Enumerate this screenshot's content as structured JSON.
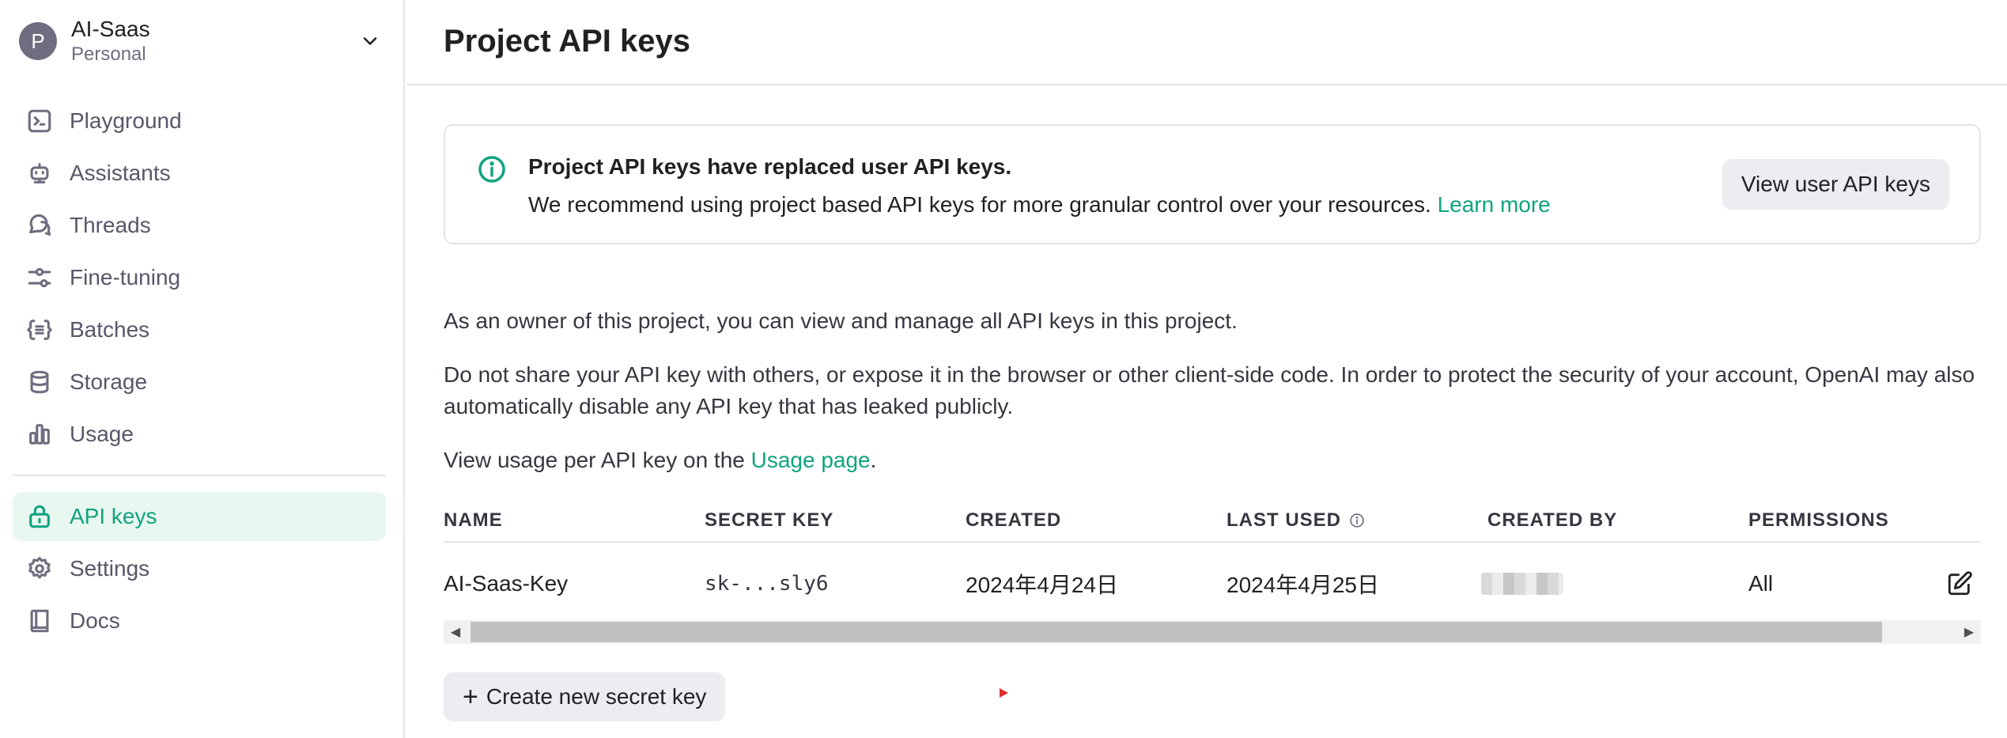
{
  "org": {
    "avatar_letter": "P",
    "name": "AI-Saas",
    "subtitle": "Personal"
  },
  "sidebar": {
    "items": [
      {
        "label": "Playground",
        "icon": "terminal-icon"
      },
      {
        "label": "Assistants",
        "icon": "robot-icon"
      },
      {
        "label": "Threads",
        "icon": "chat-bubbles-icon"
      },
      {
        "label": "Fine-tuning",
        "icon": "sliders-icon"
      },
      {
        "label": "Batches",
        "icon": "braces-list-icon"
      },
      {
        "label": "Storage",
        "icon": "database-icon"
      },
      {
        "label": "Usage",
        "icon": "bar-chart-icon"
      }
    ],
    "bottom_items": [
      {
        "label": "API keys",
        "icon": "lock-icon",
        "active": true
      },
      {
        "label": "Settings",
        "icon": "gear-icon"
      },
      {
        "label": "Docs",
        "icon": "book-icon"
      }
    ]
  },
  "header": {
    "title": "Project API keys"
  },
  "notice": {
    "title": "Project API keys have replaced user API keys.",
    "body": "We recommend using project based API keys for more granular control over your resources.",
    "link": "Learn more",
    "button": "View user API keys"
  },
  "info": {
    "p1": "As an owner of this project, you can view and manage all API keys in this project.",
    "p2": "Do not share your API key with others, or expose it in the browser or other client-side code. In order to protect the security of your account, OpenAI may also automatically disable any API key that has leaked publicly.",
    "p3_prefix": "View usage per API key on the",
    "p3_link": "Usage page",
    "p3_suffix": "."
  },
  "table": {
    "columns": [
      "NAME",
      "SECRET KEY",
      "CREATED",
      "LAST USED",
      "CREATED BY",
      "PERMISSIONS"
    ],
    "rows": [
      {
        "name": "AI-Saas-Key",
        "secret": "sk-...sly6",
        "created": "2024年4月24日",
        "last_used": "2024年4月25日",
        "permissions": "All"
      }
    ]
  },
  "actions": {
    "create_button": "Create new secret key"
  },
  "colors": {
    "accent": "#10a37f",
    "active_bg": "#e8f7ef",
    "button_bg": "#ececf1"
  }
}
